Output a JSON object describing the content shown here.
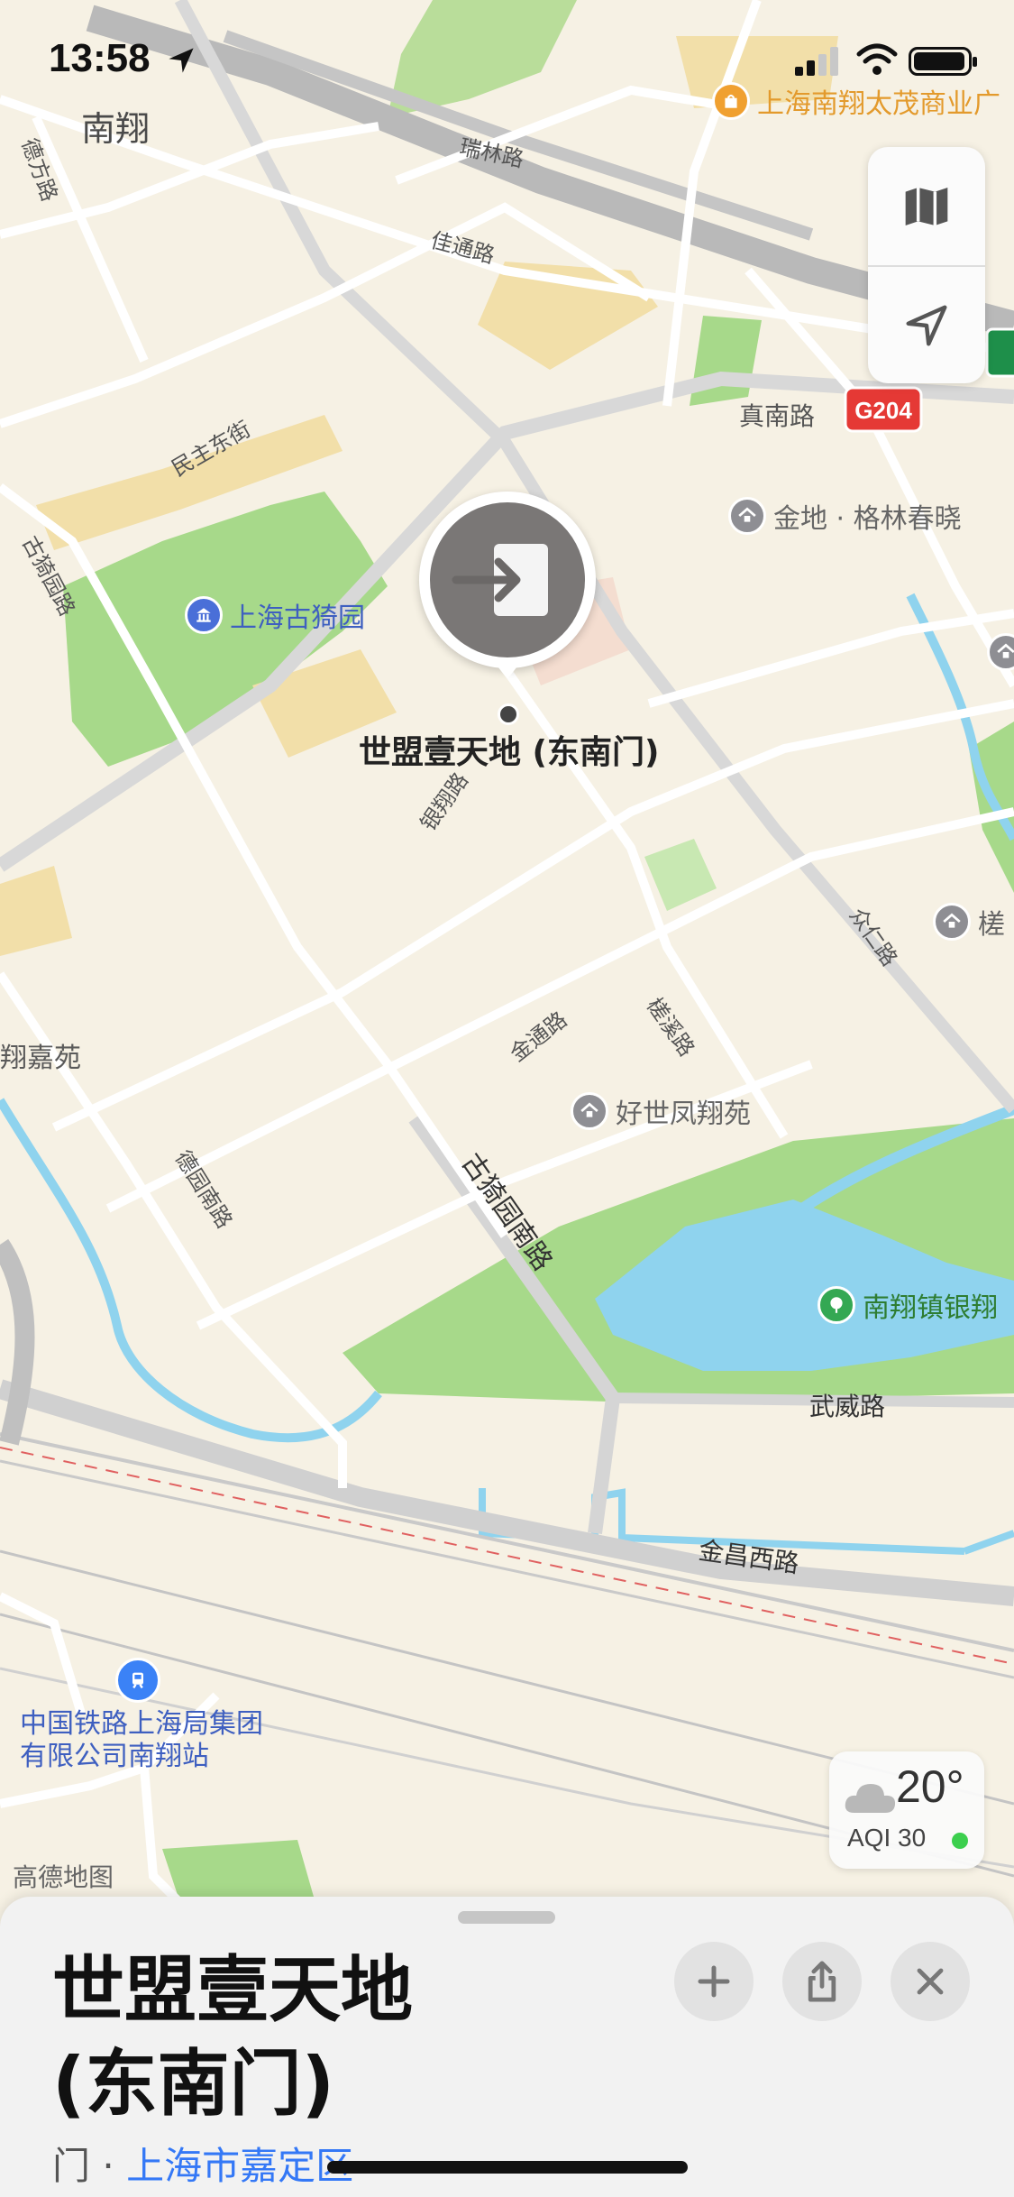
{
  "status_bar": {
    "time": "13:58"
  },
  "map": {
    "selected_place": {
      "name": "世盟壹天地 (东南门)"
    },
    "area_labels": {
      "nanxiang": "南翔",
      "xiangjiayuan": "翔嘉苑"
    },
    "roads": {
      "ruilin": "瑞林路",
      "jiatong": "佳通路",
      "zhennan": "真南路",
      "highway_badge": "G204",
      "minzhu_east": "民主东街",
      "defang": "德方路",
      "guyiyuan": "古猗园路",
      "yinxiang": "银翔路",
      "jintong": "金通路",
      "cuoxi": "槎溪路",
      "zhongren": "众仁路",
      "deyuan_south": "德园南路",
      "guyiyuan_south": "古猗园南路",
      "wuwei": "武威路",
      "jinchang_west": "金昌西路"
    },
    "pois": {
      "top_shopping": "上海南翔太茂商业广",
      "guyiyuan_park": "上海古猗园",
      "jindi": "金地 · 格林春晓",
      "haoshi": "好世凤翔苑",
      "yinxiang_park": "南翔镇银翔",
      "right_edge": "槎",
      "station": "中国铁路上海局集团有限公司南翔站"
    },
    "attribution": "高德地图"
  },
  "map_controls": {
    "map_mode_icon": "map-icon",
    "location_icon": "location-arrow-icon"
  },
  "weather": {
    "temperature": "20°",
    "aqi": "AQI 30",
    "aqi_color": "#3ccf4e"
  },
  "place_card": {
    "title": "世盟壹天地 (东南门)",
    "category": "门",
    "separator": " · ",
    "location": "上海市嘉定区",
    "actions": {
      "add_icon": "plus-icon",
      "share_icon": "share-icon",
      "close_icon": "close-icon"
    }
  },
  "colors": {
    "accent": "#3478f6",
    "highway_badge": "#e53935"
  }
}
